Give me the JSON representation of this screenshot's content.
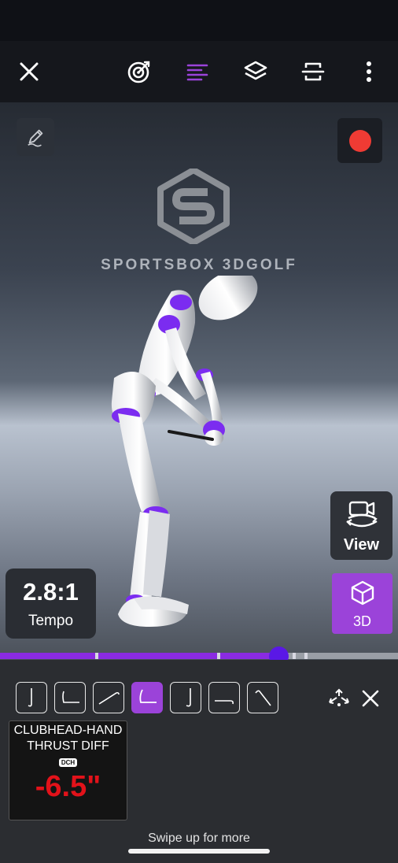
{
  "toolbar": {
    "close_icon": "close-icon",
    "items": [
      "target-icon",
      "lines-icon",
      "layers-icon",
      "frame-icon",
      "more-icon"
    ],
    "active_color": "#9b43d9"
  },
  "brand": {
    "name": "SPORTSBOX 3DGOLF"
  },
  "tempo": {
    "value": "2.8:1",
    "label": "Tempo"
  },
  "view_button": {
    "label": "View"
  },
  "mode_button": {
    "label": "3D"
  },
  "timeline": {
    "progress": 0.7,
    "ticks": [
      0.24,
      0.545,
      0.735,
      0.765
    ]
  },
  "positions": {
    "count": 7,
    "active_index": 3
  },
  "metric": {
    "title": "CLUBHEAD-HAND THRUST DIFF",
    "badge": "DCH",
    "value": "-6.5\"",
    "value_color": "#e2121a"
  },
  "footer": {
    "hint": "Swipe up for more"
  }
}
